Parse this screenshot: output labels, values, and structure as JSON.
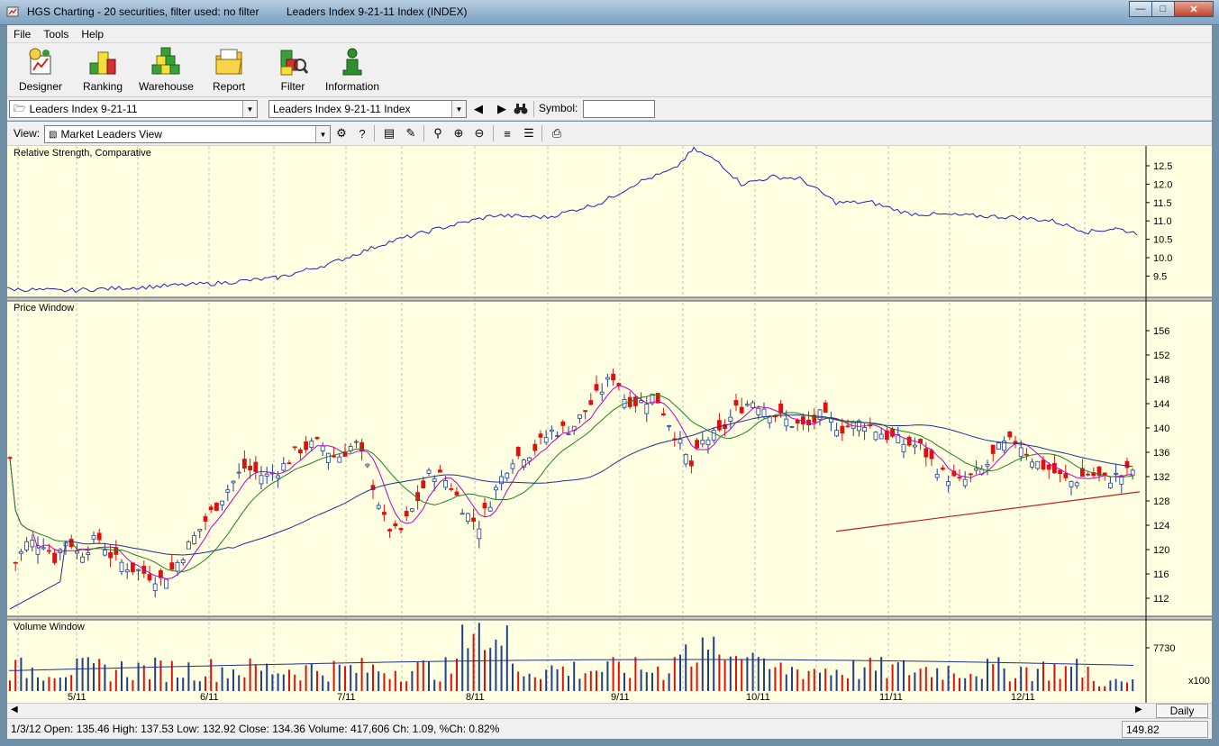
{
  "window": {
    "title": "HGS Charting - 20 securities, filter used: no filter",
    "document": "Leaders Index 9-21-11 Index (INDEX)",
    "buttons": [
      "minimize",
      "maximize",
      "close"
    ]
  },
  "menu": [
    "File",
    "Tools",
    "Help"
  ],
  "toolbar": [
    {
      "label": "Designer",
      "icon": "designer-icon"
    },
    {
      "label": "Ranking",
      "icon": "ranking-icon"
    },
    {
      "label": "Warehouse",
      "icon": "warehouse-icon"
    },
    {
      "label": "Report",
      "icon": "report-icon"
    },
    {
      "label": "Filter",
      "icon": "filter-icon"
    },
    {
      "label": "Information",
      "icon": "information-icon"
    }
  ],
  "selectors": {
    "folder_value": "Leaders Index 9-21-11",
    "security_value": "Leaders Index 9-21-11 Index",
    "symbol_label": "Symbol:",
    "symbol_value": "",
    "view_label": "View:",
    "view_value": "Market Leaders View"
  },
  "panes": {
    "rs_title": "Relative Strength, Comparative",
    "price_title": "Price Window",
    "volume_title": "Volume Window"
  },
  "axes": {
    "rs_ticks": [
      "12.5",
      "12.0",
      "11.5",
      "11.0",
      "10.5",
      "10.0",
      "9.5"
    ],
    "price_ticks": [
      "156",
      "152",
      "148",
      "144",
      "140",
      "136",
      "132",
      "128",
      "124",
      "120",
      "116",
      "112"
    ],
    "volume_ticks": [
      "7730"
    ],
    "volume_multiplier": "x100",
    "date_labels": [
      "5/11",
      "6/11",
      "7/11",
      "8/11",
      "9/11",
      "10/11",
      "11/11",
      "12/11"
    ]
  },
  "status": {
    "text": "1/3/12 Open: 135.46 High: 137.53 Low: 132.92 Close: 134.36 Volume: 417,606 Ch: 1.09, %Ch: 0.82%",
    "right_value": "149.82",
    "period_tab": "Daily"
  },
  "colors": {
    "chart_bg": "#ffffe1",
    "up_candle": "#1f3f8f",
    "down_candle": "#e01010",
    "rs_line": "#2020c0",
    "ma_short": "#c000c0",
    "ma_mid": "#208020",
    "ma_long": "#203090",
    "trendline": "#c02020"
  }
}
